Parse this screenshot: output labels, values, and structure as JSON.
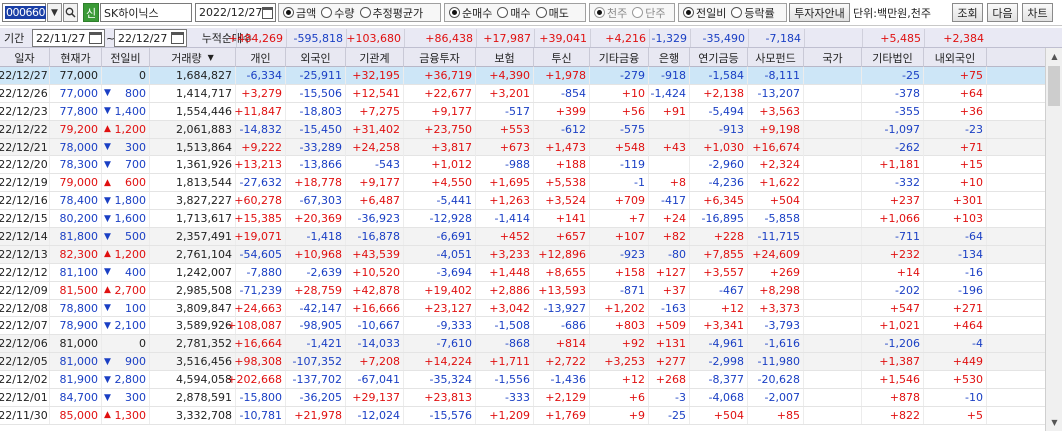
{
  "toolbar": {
    "stock_code": "000660",
    "search_icon": "search-icon",
    "dropdown_icon": "chevron-down-icon",
    "credit_badge": "신",
    "stock_name": "SK하이닉스",
    "date": "2022/12/27",
    "amount_group": [
      {
        "label": "금액",
        "checked": true
      },
      {
        "label": "수량",
        "checked": false
      },
      {
        "label": "추정평균가",
        "checked": false
      }
    ],
    "trade_group": [
      {
        "label": "순매수",
        "checked": true
      },
      {
        "label": "매수",
        "checked": false
      },
      {
        "label": "매도",
        "checked": false
      }
    ],
    "unit_group": [
      {
        "label": "천주",
        "checked": true
      },
      {
        "label": "단주",
        "checked": false
      }
    ],
    "compare_group": [
      {
        "label": "전일비",
        "checked": true
      },
      {
        "label": "등락률",
        "checked": false
      }
    ],
    "investor_guide_label": "투자자안내",
    "unit_text": "단위:백만원,천주",
    "search_label": "조회",
    "next_label": "다음",
    "chart_label": "차트"
  },
  "period": {
    "label": "기간",
    "from": "22/11/27",
    "to": "22/12/27",
    "cum_label": "누적순매수",
    "sums": [
      "+484,269",
      "-595,818",
      "+103,680",
      "+86,438",
      "+17,987",
      "+39,041",
      "+4,216",
      "-1,329",
      "-35,490",
      "-7,184",
      "",
      "+5,485",
      "+2,384"
    ]
  },
  "columns": [
    "일자",
    "현재가",
    "전일비",
    "거래량",
    "개인",
    "외국인",
    "기관계",
    "금융투자",
    "보험",
    "투신",
    "기타금융",
    "은행",
    "연기금등",
    "사모펀드",
    "국가",
    "기타법인",
    "내외국인"
  ],
  "rows": [
    {
      "date": "22/12/27",
      "price": "77,000",
      "dir": "",
      "chg": "0",
      "vol": "1,684,827",
      "v": [
        "-6,334",
        "-25,911",
        "+32,195",
        "+36,719",
        "+4,390",
        "+1,978",
        "-279",
        "-918",
        "-1,584",
        "-8,111",
        "",
        "-25",
        "+75"
      ]
    },
    {
      "date": "22/12/26",
      "price": "77,000",
      "dir": "down",
      "chg": "800",
      "vol": "1,414,717",
      "v": [
        "+3,279",
        "-15,506",
        "+12,541",
        "+22,677",
        "+3,201",
        "-854",
        "+10",
        "-1,424",
        "+2,138",
        "-13,207",
        "",
        "-378",
        "+64"
      ]
    },
    {
      "date": "22/12/23",
      "price": "77,800",
      "dir": "down",
      "chg": "1,400",
      "vol": "1,554,446",
      "v": [
        "+11,847",
        "-18,803",
        "+7,275",
        "+9,177",
        "-517",
        "+399",
        "+56",
        "+91",
        "-5,494",
        "+3,563",
        "",
        "-355",
        "+36"
      ]
    },
    {
      "date": "22/12/22",
      "price": "79,200",
      "dir": "up",
      "chg": "1,200",
      "vol": "2,061,883",
      "v": [
        "-14,832",
        "-15,450",
        "+31,402",
        "+23,750",
        "+553",
        "-612",
        "-575",
        "",
        "-913",
        "+9,198",
        "",
        "-1,097",
        "-23"
      ]
    },
    {
      "date": "22/12/21",
      "price": "78,000",
      "dir": "down",
      "chg": "300",
      "vol": "1,513,864",
      "v": [
        "+9,222",
        "-33,289",
        "+24,258",
        "+3,817",
        "+673",
        "+1,473",
        "+548",
        "+43",
        "+1,030",
        "+16,674",
        "",
        "-262",
        "+71"
      ]
    },
    {
      "date": "22/12/20",
      "price": "78,300",
      "dir": "down",
      "chg": "700",
      "vol": "1,361,926",
      "v": [
        "+13,213",
        "-13,866",
        "-543",
        "+1,012",
        "-988",
        "+188",
        "-119",
        "",
        "-2,960",
        "+2,324",
        "",
        "+1,181",
        "+15"
      ]
    },
    {
      "date": "22/12/19",
      "price": "79,000",
      "dir": "up",
      "chg": "600",
      "vol": "1,813,544",
      "v": [
        "-27,632",
        "+18,778",
        "+9,177",
        "+4,550",
        "+1,695",
        "+5,538",
        "-1",
        "+8",
        "-4,236",
        "+1,622",
        "",
        "-332",
        "+10"
      ]
    },
    {
      "date": "22/12/16",
      "price": "78,400",
      "dir": "down",
      "chg": "1,800",
      "vol": "3,827,227",
      "v": [
        "+60,278",
        "-67,303",
        "+6,487",
        "-5,441",
        "+1,263",
        "+3,524",
        "+709",
        "-417",
        "+6,345",
        "+504",
        "",
        "+237",
        "+301"
      ]
    },
    {
      "date": "22/12/15",
      "price": "80,200",
      "dir": "down",
      "chg": "1,600",
      "vol": "1,713,617",
      "v": [
        "+15,385",
        "+20,369",
        "-36,923",
        "-12,928",
        "-1,414",
        "+141",
        "+7",
        "+24",
        "-16,895",
        "-5,858",
        "",
        "+1,066",
        "+103"
      ]
    },
    {
      "date": "22/12/14",
      "price": "81,800",
      "dir": "down",
      "chg": "500",
      "vol": "2,357,491",
      "v": [
        "+19,071",
        "-1,418",
        "-16,878",
        "-6,691",
        "+452",
        "+657",
        "+107",
        "+82",
        "+228",
        "-11,715",
        "",
        "-711",
        "-64"
      ]
    },
    {
      "date": "22/12/13",
      "price": "82,300",
      "dir": "up",
      "chg": "1,200",
      "vol": "2,761,104",
      "v": [
        "-54,605",
        "+10,968",
        "+43,539",
        "-4,051",
        "+3,233",
        "+12,896",
        "-923",
        "-80",
        "+7,855",
        "+24,609",
        "",
        "+232",
        "-134"
      ]
    },
    {
      "date": "22/12/12",
      "price": "81,100",
      "dir": "down",
      "chg": "400",
      "vol": "1,242,007",
      "v": [
        "-7,880",
        "-2,639",
        "+10,520",
        "-3,694",
        "+1,448",
        "+8,655",
        "+158",
        "+127",
        "+3,557",
        "+269",
        "",
        "+14",
        "-16"
      ]
    },
    {
      "date": "22/12/09",
      "price": "81,500",
      "dir": "up",
      "chg": "2,700",
      "vol": "2,985,508",
      "v": [
        "-71,239",
        "+28,759",
        "+42,878",
        "+19,402",
        "+2,886",
        "+13,593",
        "-871",
        "+37",
        "-467",
        "+8,298",
        "",
        "-202",
        "-196"
      ]
    },
    {
      "date": "22/12/08",
      "price": "78,800",
      "dir": "down",
      "chg": "100",
      "vol": "3,809,847",
      "v": [
        "+24,663",
        "-42,147",
        "+16,666",
        "+23,127",
        "+3,042",
        "-13,927",
        "+1,202",
        "-163",
        "+12",
        "+3,373",
        "",
        "+547",
        "+271"
      ]
    },
    {
      "date": "22/12/07",
      "price": "78,900",
      "dir": "down",
      "chg": "2,100",
      "vol": "3,589,926",
      "v": [
        "+108,087",
        "-98,905",
        "-10,667",
        "-9,333",
        "-1,508",
        "-686",
        "+803",
        "+509",
        "+3,341",
        "-3,793",
        "",
        "+1,021",
        "+464"
      ]
    },
    {
      "date": "22/12/06",
      "price": "81,000",
      "dir": "",
      "chg": "0",
      "vol": "2,781,352",
      "v": [
        "+16,664",
        "-1,421",
        "-14,033",
        "-7,610",
        "-868",
        "+814",
        "+92",
        "+131",
        "-4,961",
        "-1,616",
        "",
        "-1,206",
        "-4"
      ]
    },
    {
      "date": "22/12/05",
      "price": "81,000",
      "dir": "down",
      "chg": "900",
      "vol": "3,516,456",
      "v": [
        "+98,308",
        "-107,352",
        "+7,208",
        "+14,224",
        "+1,711",
        "+2,722",
        "+3,253",
        "+277",
        "-2,998",
        "-11,980",
        "",
        "+1,387",
        "+449"
      ]
    },
    {
      "date": "22/12/02",
      "price": "81,900",
      "dir": "down",
      "chg": "2,800",
      "vol": "4,594,058",
      "v": [
        "+202,668",
        "-137,702",
        "-67,041",
        "-35,324",
        "-1,556",
        "-1,436",
        "+12",
        "+268",
        "-8,377",
        "-20,628",
        "",
        "+1,546",
        "+530"
      ]
    },
    {
      "date": "22/12/01",
      "price": "84,700",
      "dir": "down",
      "chg": "300",
      "vol": "2,878,591",
      "v": [
        "-15,800",
        "-36,205",
        "+29,137",
        "+23,813",
        "-333",
        "+2,129",
        "+6",
        "-3",
        "-4,068",
        "-2,007",
        "",
        "+878",
        "-10"
      ]
    },
    {
      "date": "22/11/30",
      "price": "85,000",
      "dir": "up",
      "chg": "1,300",
      "vol": "3,332,708",
      "v": [
        "-10,781",
        "+21,978",
        "-12,024",
        "-15,576",
        "+1,209",
        "+1,769",
        "+9",
        "-25",
        "+504",
        "+85",
        "",
        "+822",
        "+5"
      ]
    }
  ],
  "colors": {
    "up": "#e01010",
    "down": "#1a3fc4",
    "header_bg": "#e8e8f2",
    "selected_row": "#cde6f7"
  }
}
